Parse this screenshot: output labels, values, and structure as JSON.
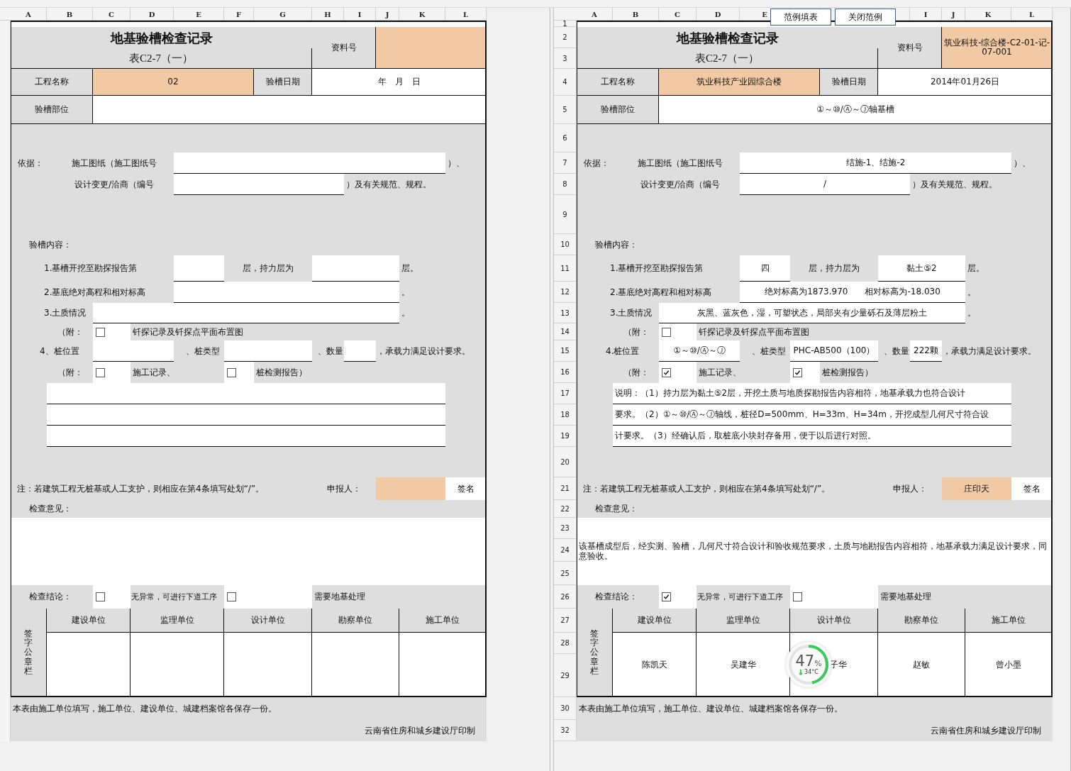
{
  "sheets": [
    {
      "column_headers": [
        {
          "kind": "letter",
          "label": "A"
        },
        {
          "kind": "letter",
          "label": "B"
        },
        {
          "kind": "letter",
          "label": "C"
        },
        {
          "kind": "letter",
          "label": "D"
        },
        {
          "kind": "letter",
          "label": "E"
        },
        {
          "kind": "letter",
          "label": "F"
        },
        {
          "kind": "letter",
          "label": "G"
        },
        {
          "kind": "letter",
          "label": "H"
        },
        {
          "kind": "letter",
          "label": "I"
        },
        {
          "kind": "letter",
          "label": "J"
        },
        {
          "kind": "letter",
          "label": "K"
        },
        {
          "kind": "letter",
          "label": "L"
        }
      ],
      "title": "地基验槽检查记录",
      "subtitle": "表C2-7（一）",
      "doc_no_label": "资料号",
      "project_label": "工程名称",
      "project": "02",
      "date_label": "验槽日期",
      "date": "年　月　日",
      "location_label": "验槽部位",
      "basis_label": "依据：",
      "drawings_label": "施工图纸（施工图纸号",
      "drawings_suffix": "）、",
      "change_label": "设计变更/洽商（编号",
      "change_suffix": "）及有关规范、规程。",
      "content_label": "验槽内容：",
      "layer_label": "1.基槽开挖至勘探报告第",
      "layer_mid": "层，持力层为",
      "layer_suffix": "层。",
      "elevation_label": "2.基底绝对高程和相对标高",
      "elevation_suffix": "。",
      "soil_label": "3.土质情况",
      "soil_suffix": "。",
      "attach_label_1": "（附：",
      "probe_attachment": {
        "label": "钎探记录及钎探点平面布置图",
        "checked": false
      },
      "pile_label": "4、桩位置",
      "pile_type_label": "、桩类型",
      "quantity_label": "、数量",
      "pile_suffix": "，承载力满足设计要求。",
      "attach_label_2": "（附：",
      "construction_record": {
        "label": "施工记录、",
        "checked": false
      },
      "pile_test": {
        "label": "桩检测报告）",
        "checked": false
      },
      "note": "注：若建筑工程无桩基或人工支护，则相应在第4条填写处划“/”。",
      "reporter_label": "申报人：",
      "sign_label": "签名",
      "opinion_label": "检查意见：",
      "conclusion_label": "检查结论：",
      "conclusions": [
        {
          "label": "无异常，可进行下道工序",
          "checked": false
        },
        {
          "label": "需要地基处理",
          "checked": false
        }
      ],
      "signature_label": "签字公章栏",
      "units": [
        {
          "name": "建设单位"
        },
        {
          "name": "监理单位"
        },
        {
          "name": "设计单位"
        },
        {
          "name": "勘察单位"
        },
        {
          "name": "施工单位"
        }
      ],
      "footer_note": "本表由施工单位填写，施工单位、建设单位、城建档案馆各保存一份。",
      "printer": "云南省住房和城乡建设厅印制"
    },
    {
      "row_numbers": [
        "1",
        "2",
        "3",
        "4",
        "5",
        "6",
        "7",
        "8",
        "9",
        "10",
        "11",
        "12",
        "13",
        "14",
        "15",
        "16",
        "17",
        "18",
        "19",
        "20",
        "21",
        "22",
        "23",
        "24",
        "25",
        "26",
        "27",
        "28",
        "29",
        "30",
        "32"
      ],
      "buttons": [
        "范例填表",
        "关闭范例"
      ],
      "column_headers": [
        {
          "kind": "letter",
          "label": "A"
        },
        {
          "kind": "letter",
          "label": "B"
        },
        {
          "kind": "letter",
          "label": "C"
        },
        {
          "kind": "letter",
          "label": "D"
        },
        {
          "kind": "letter",
          "label": "E"
        },
        {
          "kind": "covered"
        },
        {
          "kind": "covered"
        },
        {
          "kind": "covered"
        },
        {
          "kind": "letter",
          "label": "I"
        },
        {
          "kind": "letter",
          "label": "J"
        },
        {
          "kind": "letter",
          "label": "K"
        },
        {
          "kind": "letter",
          "label": "L"
        }
      ],
      "title": "地基验槽检查记录",
      "subtitle": "表C2-7（一）",
      "doc_no_label": "资料号",
      "doc_no": "筑业科技-综合楼-C2-01-记-07-001",
      "project_label": "工程名称",
      "project": "筑业科技产业园综合楼",
      "date_label": "验槽日期",
      "date": "2014年01月26日",
      "location_label": "验槽部位",
      "location": "①～⑩/Ⓐ～Ⓙ轴基槽",
      "basis_label": "依据：",
      "drawings_label": "施工图纸（施工图纸号",
      "drawings": "结施-1、结施-2",
      "drawings_suffix": "）、",
      "change_label": "设计变更/洽商（编号",
      "change": "/",
      "change_suffix": "）及有关规范、规程。",
      "content_label": "验槽内容：",
      "layer_label": "1.基槽开挖至勘探报告第",
      "layer": "四",
      "layer_mid": "层，持力层为",
      "bearing_layer": "黏土⑤2",
      "layer_suffix": "层。",
      "elevation_label": "2.基底绝对高程和相对标高",
      "elevation": "绝对标高为1873.970　　相对标高为-18.030",
      "elevation_suffix": "。",
      "soil_label": "3.土质情况",
      "soil": "灰黑、蓝灰色，湿，可塑状态，局部夹有少量砾石及薄层粉土",
      "soil_suffix": "。",
      "attach_label_1": "（附：",
      "probe_attachment": {
        "label": "钎探记录及钎探点平面布置图",
        "checked": false
      },
      "pile_label": "4.桩位置",
      "pile_position": "①～⑩/Ⓐ～Ⓙ",
      "pile_type_label": "、桩类型",
      "pile_type": "PHC-AB500（100）",
      "quantity_label": "、数量",
      "quantity": "222颗",
      "pile_suffix": "，承载力满足设计要求。",
      "attach_label_2": "（附：",
      "construction_record": {
        "label": "施工记录、",
        "checked": true
      },
      "pile_test": {
        "label": "桩检测报告）",
        "checked": true
      },
      "notes": [
        "说明：（1）持力层为黏土⑤2层，开挖土质与地质探勘报告内容相符，地基承载力也符合设计",
        "要求。（2）①～⑩/Ⓐ～Ⓙ轴线，桩径D=500mm、H=33m、H=34m，开挖成型几何尺寸符合设",
        "计要求。（3）经确认后，取桩底小块封存备用，便于以后进行对照。"
      ],
      "note": "注：若建筑工程无桩基或人工支护，则相应在第4条填写处划“/”。",
      "reporter_label": "申报人：",
      "reporter": "庄印天",
      "sign_label": "签名",
      "opinion_label": "检查意见：",
      "opinion": "该基槽成型后，经实测、验槽，几何尺寸符合设计和验收规范要求，土质与地勘报告内容相符，地基承载力满足设计要求，同意验收。",
      "conclusion_label": "检查结论：",
      "conclusions": [
        {
          "label": "无异常，可进行下道工序",
          "checked": true
        },
        {
          "label": "需要地基处理",
          "checked": false
        }
      ],
      "signature_label": "签字公章栏",
      "units": [
        {
          "name": "建设单位",
          "signer": "陈凯天"
        },
        {
          "name": "监理单位",
          "signer": "吴建华"
        },
        {
          "name": "设计单位",
          "signer": "子华",
          "widget": {
            "value": "47",
            "unit": "%",
            "temperature": "34°C",
            "level": 0.47
          }
        },
        {
          "name": "勘察单位",
          "signer": "赵敏"
        },
        {
          "name": "施工单位",
          "signer": "曾小墨"
        }
      ],
      "footer_note": "本表由施工单位填写，施工单位、建设单位、城建档案馆各保存一份。",
      "printer": "云南省住房和城乡建设厅印制"
    }
  ]
}
